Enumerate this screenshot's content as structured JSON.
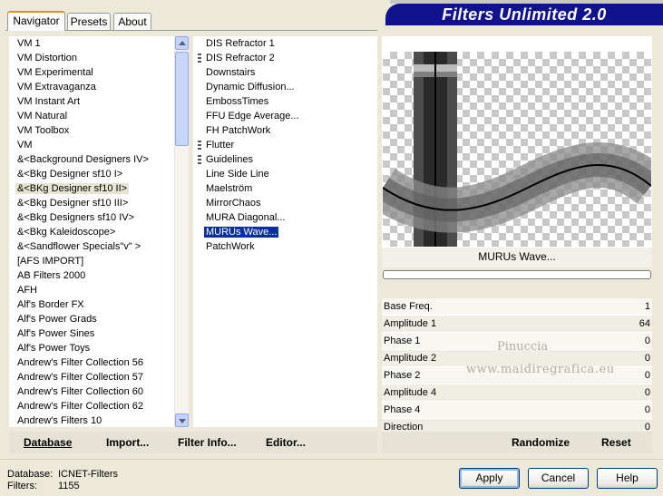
{
  "tabs": [
    {
      "label": "Navigator",
      "active": true
    },
    {
      "label": "Presets",
      "active": false
    },
    {
      "label": "About",
      "active": false
    }
  ],
  "banner_title": "Filters Unlimited 2.0",
  "categories": [
    "VM 1",
    "VM Distortion",
    "VM Experimental",
    "VM Extravaganza",
    "VM Instant Art",
    "VM Natural",
    "VM Toolbox",
    "VM",
    "&<Background Designers IV>",
    "&<Bkg Designer sf10 I>",
    "&<BKg Designer sf10 II>",
    "&<Bkg Designer sf10 III>",
    "&<Bkg Designers sf10 IV>",
    "&<Bkg Kaleidoscope>",
    "&<Sandflower Specials\"v\" >",
    "[AFS IMPORT]",
    "AB Filters 2000",
    "AFH",
    "Alf's Border FX",
    "Alf's Power Grads",
    "Alf's Power Sines",
    "Alf's Power Toys",
    "Andrew's Filter Collection 56",
    "Andrew's Filter Collection 57",
    "Andrew's Filter Collection 60",
    "Andrew's Filter Collection 62",
    "Andrew's Filters 10"
  ],
  "selected_category": "&<BKg Designer sf10 II>",
  "filters": [
    {
      "label": "DIS Refractor 1",
      "grip": false
    },
    {
      "label": "DIS Refractor 2",
      "grip": true
    },
    {
      "label": "Downstairs",
      "grip": false
    },
    {
      "label": "Dynamic Diffusion...",
      "grip": false
    },
    {
      "label": "EmbossTimes",
      "grip": false
    },
    {
      "label": "FFU Edge Average...",
      "grip": false
    },
    {
      "label": "FH PatchWork",
      "grip": false
    },
    {
      "label": "Flutter",
      "grip": true
    },
    {
      "label": "Guidelines",
      "grip": true
    },
    {
      "label": "Line Side Line",
      "grip": false
    },
    {
      "label": "Maelström",
      "grip": false
    },
    {
      "label": "MirrorChaos",
      "grip": false
    },
    {
      "label": "MURA Diagonal...",
      "grip": false
    },
    {
      "label": "MURUs Wave...",
      "grip": false
    },
    {
      "label": "PatchWork",
      "grip": false
    }
  ],
  "selected_filter": "MURUs Wave...",
  "left_buttons": [
    "Database",
    "Import...",
    "Filter Info...",
    "Editor..."
  ],
  "preview_filter_name": "MURUs Wave...",
  "progress": 0,
  "params": [
    {
      "label": "Base Freq.",
      "value": "1"
    },
    {
      "label": "Amplitude 1",
      "value": "64"
    },
    {
      "label": "Phase 1",
      "value": "0"
    },
    {
      "label": "Amplitude 2",
      "value": "0"
    },
    {
      "label": "Phase 2",
      "value": "0"
    },
    {
      "label": "Amplitude 4",
      "value": "0"
    },
    {
      "label": "Phase 4",
      "value": "0"
    },
    {
      "label": "Direction",
      "value": "0"
    }
  ],
  "watermark": {
    "line1": "Pinuccia",
    "line2": "www.maidiregrafica.eu"
  },
  "right_buttons": {
    "randomize": "Randomize",
    "reset": "Reset"
  },
  "footer": {
    "database_label": "Database:",
    "database_value": "ICNET-Filters",
    "filters_label": "Filters:",
    "filters_value": "1155"
  },
  "dialog_buttons": {
    "apply": "Apply",
    "cancel": "Cancel",
    "help": "Help"
  },
  "colors": {
    "banner": "#11138e",
    "selection": "#0a2ea4",
    "tab_accent": "#e68b2c"
  }
}
